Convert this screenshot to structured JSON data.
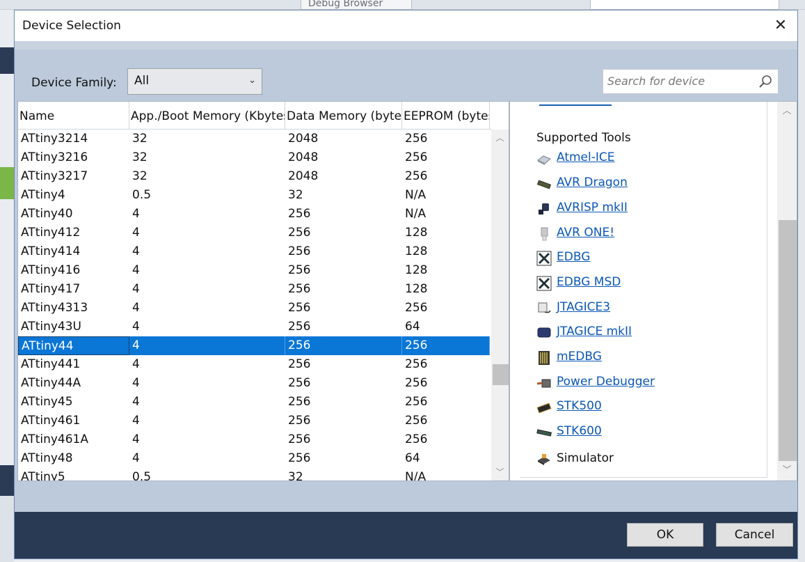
{
  "ide": {
    "debug_browser": "Debug Browser"
  },
  "dialog": {
    "title": "Device Selection",
    "close_glyph": "✕"
  },
  "filter": {
    "family_label": "Device Family:",
    "family_value": "All",
    "search_placeholder": "Search for device"
  },
  "table": {
    "columns": [
      "Name",
      "App./Boot Memory (Kbytes)",
      "Data Memory (bytes)",
      "EEPROM (bytes)"
    ],
    "rows": [
      [
        "ATtiny3214",
        "32",
        "2048",
        "256"
      ],
      [
        "ATtiny3216",
        "32",
        "2048",
        "256"
      ],
      [
        "ATtiny3217",
        "32",
        "2048",
        "256"
      ],
      [
        "ATtiny4",
        "0.5",
        "32",
        "N/A"
      ],
      [
        "ATtiny40",
        "4",
        "256",
        "N/A"
      ],
      [
        "ATtiny412",
        "4",
        "256",
        "128"
      ],
      [
        "ATtiny414",
        "4",
        "256",
        "128"
      ],
      [
        "ATtiny416",
        "4",
        "256",
        "128"
      ],
      [
        "ATtiny417",
        "4",
        "256",
        "128"
      ],
      [
        "ATtiny4313",
        "4",
        "256",
        "256"
      ],
      [
        "ATtiny43U",
        "4",
        "256",
        "64"
      ],
      [
        "ATtiny44",
        "4",
        "256",
        "256"
      ],
      [
        "ATtiny441",
        "4",
        "256",
        "256"
      ],
      [
        "ATtiny44A",
        "4",
        "256",
        "256"
      ],
      [
        "ATtiny45",
        "4",
        "256",
        "256"
      ],
      [
        "ATtiny461",
        "4",
        "256",
        "256"
      ],
      [
        "ATtiny461A",
        "4",
        "256",
        "256"
      ],
      [
        "ATtiny48",
        "4",
        "256",
        "64"
      ],
      [
        "ATtiny5",
        "0.5",
        "32",
        "N/A"
      ]
    ],
    "selected_index": 11
  },
  "tools": {
    "title": "Supported Tools",
    "items": [
      {
        "label": "Atmel-ICE",
        "icon": "atmel-ice-icon",
        "link": true
      },
      {
        "label": "AVR Dragon",
        "icon": "avr-dragon-icon",
        "link": true
      },
      {
        "label": "AVRISP mkII",
        "icon": "avrisp-icon",
        "link": true
      },
      {
        "label": "AVR ONE!",
        "icon": "avr-one-icon",
        "link": true
      },
      {
        "label": "EDBG",
        "icon": "edbg-icon",
        "link": true
      },
      {
        "label": "EDBG MSD",
        "icon": "edbg-msd-icon",
        "link": true
      },
      {
        "label": "JTAGICE3",
        "icon": "jtagice3-icon",
        "link": true
      },
      {
        "label": "JTAGICE mkII",
        "icon": "jtagice-mkii-icon",
        "link": true
      },
      {
        "label": "mEDBG",
        "icon": "medbg-icon",
        "link": true
      },
      {
        "label": "Power Debugger",
        "icon": "power-debugger-icon",
        "link": true
      },
      {
        "label": "STK500",
        "icon": "stk500-icon",
        "link": true
      },
      {
        "label": "STK600",
        "icon": "stk600-icon",
        "link": true
      },
      {
        "label": "Simulator",
        "icon": "simulator-icon",
        "link": false
      }
    ]
  },
  "footer": {
    "ok_label": "OK",
    "cancel_label": "Cancel"
  },
  "colors": {
    "selection": "#0a76d6",
    "link": "#0b57b5",
    "footer": "#293a55",
    "dialog_body": "#bccadb"
  }
}
